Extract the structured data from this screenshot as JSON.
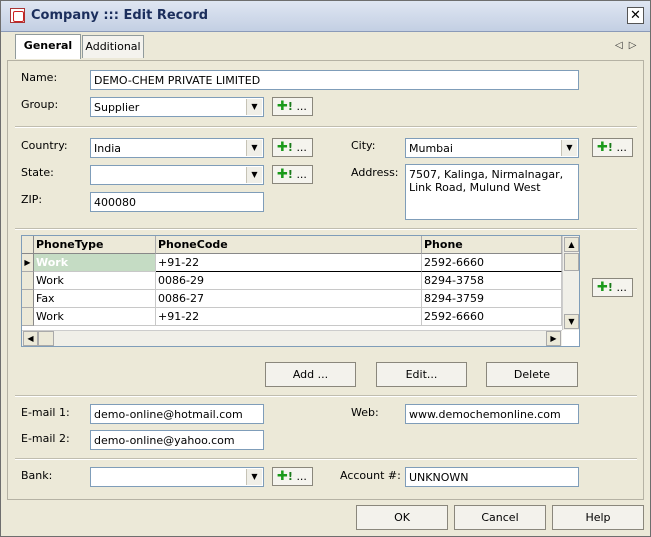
{
  "window": {
    "title": "Company ::: Edit Record",
    "close_glyph": "✕"
  },
  "tabs": [
    {
      "label": "General"
    },
    {
      "label": "Additional"
    }
  ],
  "tab_nav": {
    "prev": "◁",
    "next": "▷"
  },
  "form": {
    "name_label": "Name:",
    "name_value": "DEMO-CHEM PRIVATE LIMITED",
    "group_label": "Group:",
    "group_value": "Supplier",
    "country_label": "Country:",
    "country_value": "India",
    "city_label": "City:",
    "city_value": "Mumbai",
    "state_label": "State:",
    "state_value": "",
    "address_label": "Address:",
    "address_value": "7507, Kalinga, Nirmalnagar, Link Road, Mulund West",
    "zip_label": "ZIP:",
    "zip_value": "400080",
    "email1_label": "E-mail 1:",
    "email1_value": "demo-online@hotmail.com",
    "email2_label": "E-mail 2:",
    "email2_value": "demo-online@yahoo.com",
    "web_label": "Web:",
    "web_value": "www.demochemonline.com",
    "bank_label": "Bank:",
    "bank_value": "",
    "account_label": "Account #:",
    "account_value": "UNKNOWN"
  },
  "plus_button": {
    "plus": "✚",
    "bang": "!",
    "dots": "..."
  },
  "phones": {
    "headers": [
      "PhoneType",
      "PhoneCode",
      "Phone"
    ],
    "rows": [
      {
        "type": "Work",
        "code": "+91-22",
        "phone": "2592-6660"
      },
      {
        "type": "Work",
        "code": "0086-29",
        "phone": "8294-3758"
      },
      {
        "type": "Fax",
        "code": "0086-27",
        "phone": "8294-3759"
      },
      {
        "type": "Work",
        "code": "+91-22",
        "phone": "2592-6660"
      }
    ],
    "current_row_marker": "▶"
  },
  "actions": {
    "add": "Add ...",
    "edit": "Edit...",
    "delete": "Delete"
  },
  "footer": {
    "ok": "OK",
    "cancel": "Cancel",
    "help": "Help"
  },
  "icons": {
    "combo_arrow": "▼",
    "scroll_up": "▲",
    "scroll_down": "▼",
    "scroll_left": "◀",
    "scroll_right": "▶"
  }
}
